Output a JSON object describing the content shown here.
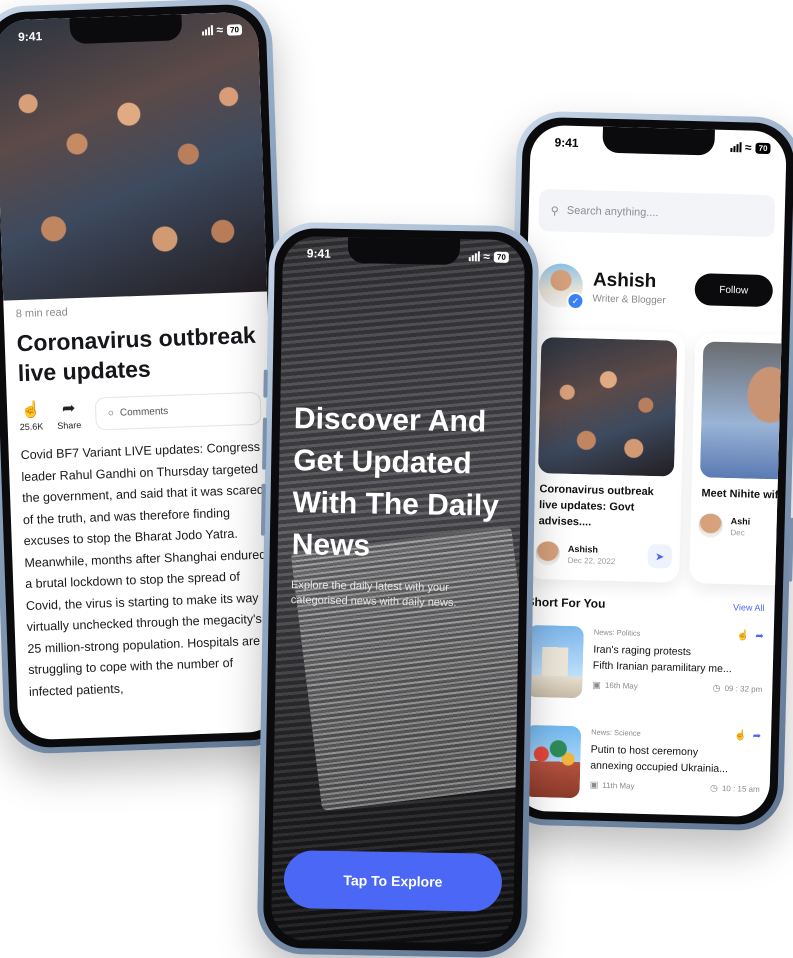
{
  "status_time": "9:41",
  "battery_level": "70",
  "article_screen": {
    "read_time": "8 min read",
    "title": "Coronavirus outbreak live updates",
    "likes_count": "25.6K",
    "share_label": "Share",
    "comments_label": "Comments",
    "body": "Covid BF7 Variant LIVE updates: Congress leader Rahul Gandhi on Thursday targeted the government, and said that it was scared of the truth, and was therefore finding excuses to stop the Bharat Jodo Yatra. Meanwhile, months after Shanghai endured a brutal lockdown to stop the spread of Covid, the virus is starting to make its way virtually unchecked through the megacity's 25 million-strong population. Hospitals are struggling to cope with the number of infected patients,"
  },
  "onboarding_screen": {
    "title": "Discover And Get Updated With The Daily News",
    "subtitle": "Explore the daily latest with your categorised news with daily news.",
    "cta_label": "Tap To Explore"
  },
  "feed_screen": {
    "search_placeholder": "Search anything....",
    "author": {
      "name": "Ashish",
      "role": "Writer & Blogger",
      "follow_label": "Follow"
    },
    "cards": [
      {
        "title": "Coronavirus outbreak live updates: Govt advises....",
        "author": "Ashish",
        "date": "Dec 22, 2022"
      },
      {
        "title": "Meet Nihite wife of Biki",
        "author": "Ashi",
        "date": "Dec"
      }
    ],
    "short_section": {
      "title": "Short For You",
      "view_all": "View All",
      "items": [
        {
          "category": "News: Politics",
          "title_line1": "Iran's raging protests",
          "title_line2": "Fifth Iranian paramilitary me...",
          "date": "16th May",
          "time": "09 : 32 pm"
        },
        {
          "category": "News: Science",
          "title_line1": "Putin to host ceremony",
          "title_line2": "annexing occupied Ukrainia...",
          "date": "11th May",
          "time": "10 : 15 am"
        }
      ]
    }
  }
}
